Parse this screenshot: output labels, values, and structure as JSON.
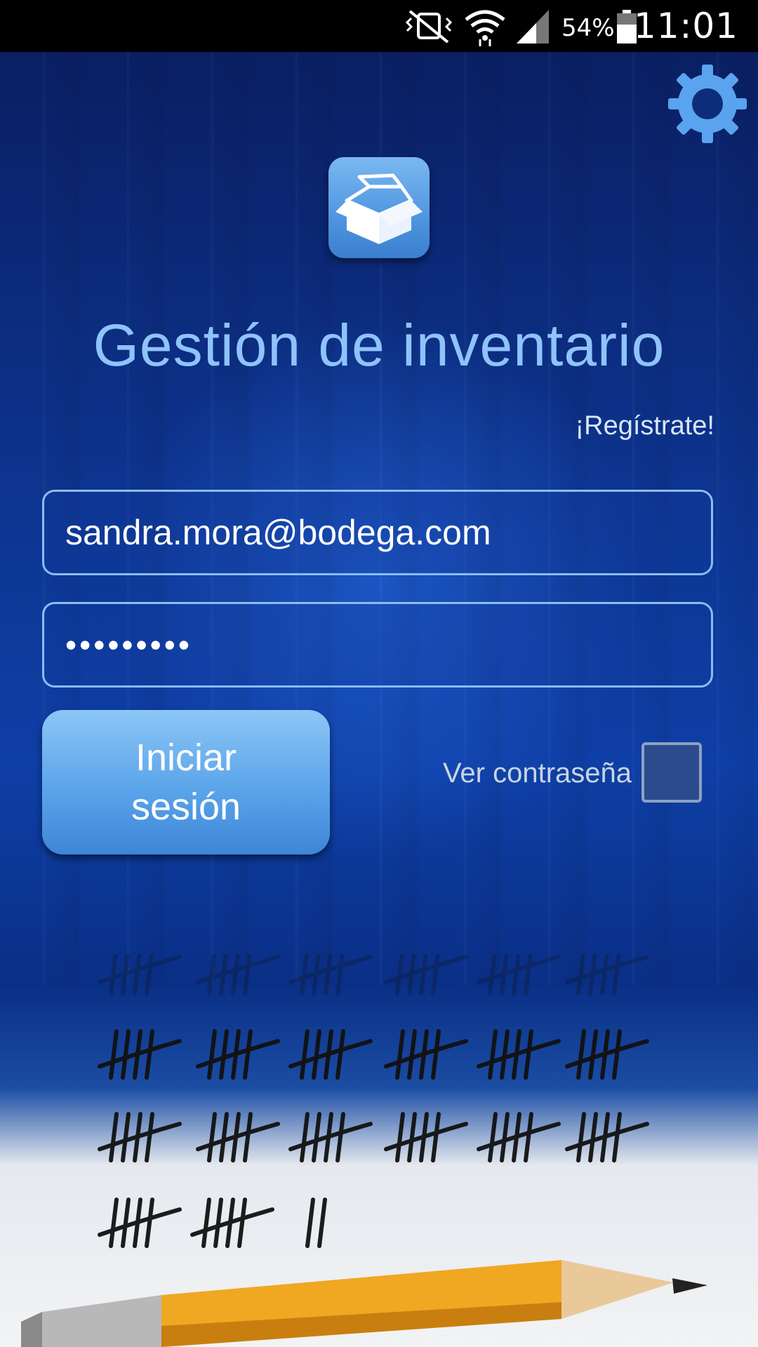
{
  "status_bar": {
    "battery_percent": "54%",
    "time": "11:01",
    "icons": [
      "vibrate-mute-icon",
      "wifi-icon",
      "signal-icon",
      "battery-icon"
    ]
  },
  "header": {
    "settings_icon": "gear-icon"
  },
  "logo": {
    "icon": "box-icon"
  },
  "title": "Gestión de inventario",
  "register_link": "¡Regístrate!",
  "form": {
    "email_value": "sandra.mora@bodega.com",
    "password_value": "•••••••••",
    "login_button": "Iniciar\nsesión",
    "show_password_label": "Ver contraseña",
    "show_password_checked": false
  },
  "colors": {
    "title": "#8ec3fb",
    "accent": "#5ba4ea",
    "field_border": "#8bbcf2",
    "background": "#0e3fa6"
  }
}
